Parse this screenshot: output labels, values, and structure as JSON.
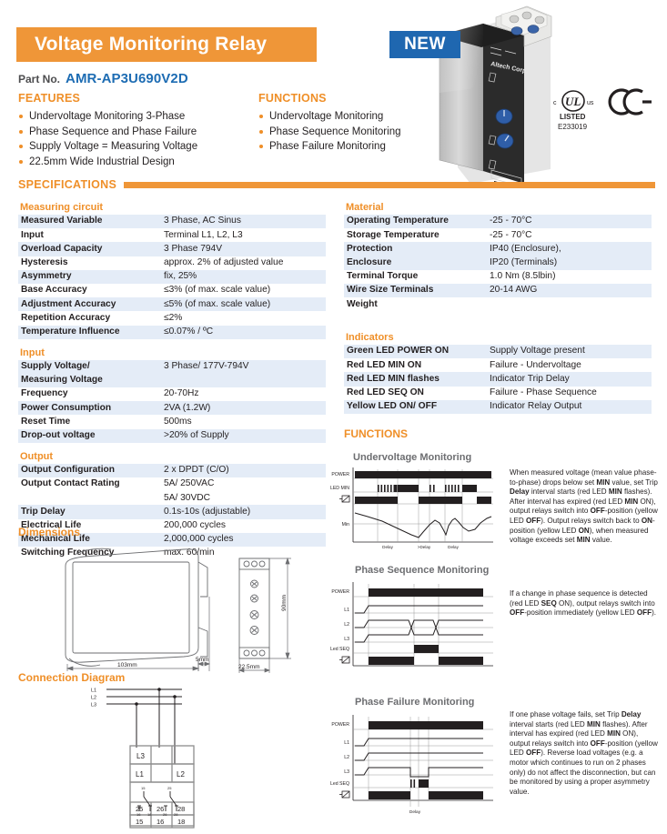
{
  "header": {
    "title": "Voltage Monitoring Relay",
    "new_badge": "NEW",
    "part_label": "Part No.",
    "part_number": "AMR-AP3U690V2D",
    "accent_orange": "#ef9638",
    "accent_blue": "#1d6cb3"
  },
  "features": {
    "heading": "FEATURES",
    "items": [
      "Undervoltage Monitoring 3-Phase",
      "Phase Sequence and Phase Failure",
      "Supply Voltage = Measuring Voltage",
      "22.5mm Wide Industrial Design"
    ]
  },
  "functions_list": {
    "heading": "FUNCTIONS",
    "items": [
      "Undervoltage Monitoring",
      "Phase Sequence Monitoring",
      "Phase Failure Monitoring"
    ]
  },
  "certifications": {
    "ul_c": "c",
    "ul_mark": "UL",
    "ul_us": "us",
    "ul_listed": "LISTED",
    "ul_file": "E233019",
    "ce_mark": "CE"
  },
  "specifications": {
    "heading": "SPECIFICATIONS",
    "left_groups": [
      {
        "title": "Measuring circuit",
        "rows": [
          {
            "key": "Measured Variable",
            "value": "3 Phase, AC Sinus"
          },
          {
            "key": "Input",
            "value": "Terminal L1, L2, L3"
          },
          {
            "key": "Overload Capacity",
            "value": "3 Phase 794V"
          },
          {
            "key": "Hysteresis",
            "value": "approx. 2% of adjusted value"
          },
          {
            "key": "Asymmetry",
            "value": "fix, 25%"
          },
          {
            "key": "Base Accuracy",
            "value": "≤3% (of max. scale value)"
          },
          {
            "key": "Adjustment Accuracy",
            "value": "≤5% (of max. scale value)"
          },
          {
            "key": "Repetition Accuracy",
            "value": "≤2%"
          },
          {
            "key": "Temperature Influence",
            "value": "≤0.07% / ºC"
          }
        ]
      },
      {
        "title": "Input",
        "rows": [
          {
            "key": "Supply Voltage/",
            "value": "3 Phase/ 177V-794V"
          },
          {
            "key": "Measuring Voltage",
            "value": ""
          },
          {
            "key": "Frequency",
            "value": "20-70Hz"
          },
          {
            "key": "Power Consumption",
            "value": "2VA (1.2W)"
          },
          {
            "key": "Reset Time",
            "value": "500ms"
          },
          {
            "key": "Drop-out voltage",
            "value": ">20% of Supply"
          }
        ]
      },
      {
        "title": "Output",
        "rows": [
          {
            "key": "Output Configuration",
            "value": "2 x DPDT (C/O)"
          },
          {
            "key": "Output Contact Rating",
            "value": "5A/ 250VAC"
          },
          {
            "key": "",
            "value": "5A/ 30VDC"
          },
          {
            "key": "Trip Delay",
            "value": "0.1s-10s (adjustable)"
          },
          {
            "key": "Electrical Life",
            "value": "200,000 cycles"
          },
          {
            "key": "Mechanical Life",
            "value": "2,000,000 cycles"
          },
          {
            "key": "Switching Frequency",
            "value": "max. 60/min"
          }
        ]
      }
    ],
    "right_groups": [
      {
        "title": "Material",
        "rows": [
          {
            "key": "Operating Temperature",
            "value": "-25 - 70°C"
          },
          {
            "key": "Storage Temperature",
            "value": "-25 - 70°C"
          },
          {
            "key": "Protection",
            "value": "IP40 (Enclosure),"
          },
          {
            "key": "Enclosure",
            "value": "IP20 (Terminals)"
          },
          {
            "key": "Terminal Torque",
            "value": "1.0 Nm (8.5lbin)"
          },
          {
            "key": "Wire Size Terminals",
            "value": "20-14 AWG"
          },
          {
            "key": "Weight",
            "value": ""
          }
        ]
      },
      {
        "title": "Indicators",
        "rows": [
          {
            "key": "Green LED POWER ON",
            "value": "Supply Voltage present"
          },
          {
            "key": "Red LED MIN ON",
            "value": "Failure - Undervoltage"
          },
          {
            "key": "Red LED MIN flashes",
            "value": "Indicator Trip Delay"
          },
          {
            "key": "Red LED SEQ ON",
            "value": "Failure - Phase Sequence"
          },
          {
            "key": "Yellow LED ON/ OFF",
            "value": "Indicator Relay Output"
          }
        ]
      }
    ]
  },
  "dimensions": {
    "heading": "Dimensions",
    "width_label": "103mm",
    "clip_label": "5mm",
    "depth_label": "22.5mm",
    "height_label": "90mm"
  },
  "connection": {
    "heading": "Connection Diagram",
    "lines": [
      "L1",
      "L2",
      "L3"
    ],
    "terminals_top": [
      "L3",
      "L1",
      "L2"
    ],
    "contact_labels": [
      "15",
      "16",
      "18",
      "25",
      "26",
      "28"
    ],
    "terminals_row1": [
      "25",
      "26",
      "28"
    ],
    "terminals_row2": [
      "15",
      "16",
      "18"
    ]
  },
  "functions_section": {
    "heading": "FUNCTIONS",
    "diagrams": [
      {
        "title": "Undervoltage Monitoring",
        "axis_labels": [
          "POWER",
          "LED MIN",
          "relay-output",
          "Min"
        ],
        "power_label": "POWER",
        "ledmin_label": "LED MIN",
        "min_label": "Min",
        "time_labels": [
          "Delay",
          ">Delay",
          "Delay"
        ],
        "paragraph_html": "When measured voltage (mean value phase-to-phase) drops below set <b>MIN</b> value, set Trip <b>Delay</b> interval starts (red LED <b>MIN</b> flashes). After interval has expired (red LED <b>MIN</b> ON), output relays switch into <b>OFF</b>-position (yellow LED <b>OFF</b>). Output relays switch back to <b>ON</b>-position (yellow LED <b>ON</b>), when measured voltage exceeds set <b>MIN</b> value."
      },
      {
        "title": "Phase Sequence Monitoring",
        "power_label": "POWER",
        "row_labels": [
          "L1",
          "L2",
          "L3",
          "Led SEQ"
        ],
        "paragraph_html": "If a change in phase sequence is detected (red LED <b>SEQ</b> ON), output relays switch into <b>OFF</b>-position immediately (yellow LED <b>OFF</b>)."
      },
      {
        "title": "Phase Failure Monitoring",
        "power_label": "POWER",
        "row_labels": [
          "L1",
          "L2",
          "L3",
          "Led SEQ"
        ],
        "time_labels": [
          "Delay"
        ],
        "paragraph_html": "If one phase voltage fails, set Trip <b>Delay</b> interval starts (red LED <b>MIN</b> flashes). After interval has expired (red LED <b>MIN</b> ON), output relays switch into <b>OFF</b>-position (yellow LED <b>OFF</b>). Reverse load voltages (e.g. a motor which continues to run on 2 phases only) do not affect the disconnection, but can be monitored by using a proper asymmetry value."
      }
    ]
  },
  "product_image": {
    "brand": "Altech Corp."
  }
}
